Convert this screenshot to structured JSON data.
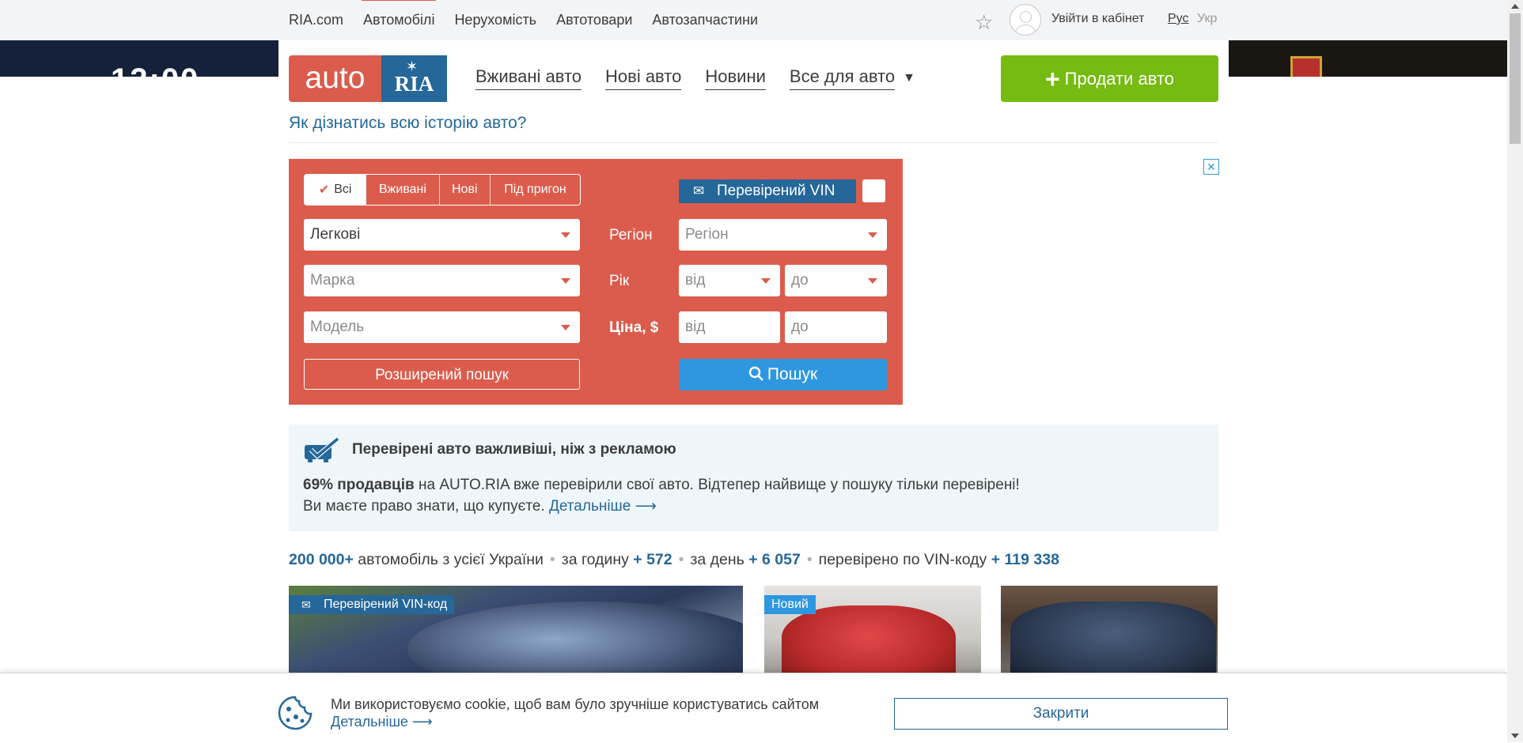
{
  "topbar": {
    "links": [
      "RIA.com",
      "Автомобілі",
      "Нерухомість",
      "Автотовари",
      "Автозапчастини"
    ],
    "active_link": "Автомобілі",
    "login": "Увійти в кабінет",
    "lang_ru": "Рус",
    "lang_uk": "Укр"
  },
  "logo": {
    "part1": "auto",
    "part2": "RIA"
  },
  "nav": {
    "used": "Вживані авто",
    "new": "Нові авто",
    "news": "Новини",
    "all": "Все для авто"
  },
  "sell_button": "Продати авто",
  "history_link": "Як дізнатись всю історію авто?",
  "search": {
    "tabs": [
      "Всі",
      "Вживані",
      "Нові",
      "Під пригон"
    ],
    "selected_tab": "Всі",
    "vin_badge": "Перевірений VIN",
    "category_value": "Легкові",
    "brand_placeholder": "Марка",
    "model_placeholder": "Модель",
    "region_label": "Регіон",
    "region_placeholder": "Регіон",
    "year_label": "Рік",
    "year_from": "від",
    "year_to": "до",
    "price_label": "Ціна, $",
    "price_from": "від",
    "price_to": "до",
    "advanced_button": "Розширений пошук",
    "search_button": "Пошук"
  },
  "ad_close": "✕",
  "notice": {
    "title": "Перевірені авто важливіші, ніж з рекламою",
    "line1_bold": "69% продавців",
    "line1_rest": " на AUTO.RIA вже перевірили свої авто. Відтепер найвище у пошуку тільки перевірені!",
    "line2": "Ви маєте право знати, що купуєте. ",
    "line2_link": "Детальніше ⟶"
  },
  "stats": {
    "total": "200 000+",
    "total_text": " автомобіль з усієї України",
    "hour_label": "за годину ",
    "hour_value": "+ 572",
    "day_label": "за день ",
    "day_value": "+ 6 057",
    "vin_label": "перевірено по VIN-коду ",
    "vin_value": "+ 119 338"
  },
  "cards": [
    {
      "tag": "Перевірений VIN-код"
    },
    {
      "tag": "Новий"
    },
    {
      "tag": ""
    }
  ],
  "cookie": {
    "text": "Ми використовуємо cookie, щоб вам було зручніше користуватись сайтом",
    "more": "Детальніше ⟶",
    "close": "Закрити"
  },
  "colors": {
    "brand_red": "#db5c4c",
    "brand_blue": "#256799",
    "sell_green": "#75bb12",
    "search_blue": "#2f97e0"
  }
}
